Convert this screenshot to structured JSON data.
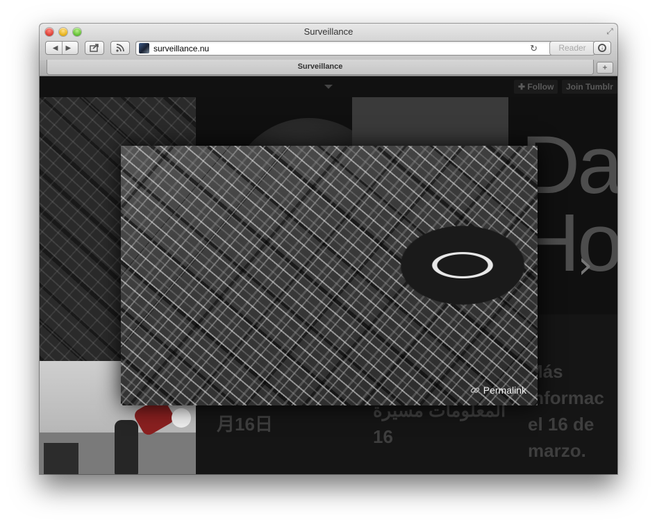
{
  "window": {
    "title": "Surveillance"
  },
  "toolbar": {
    "url": "surveillance.nu",
    "reader_label": "Reader",
    "reload_glyph": "↻",
    "back_glyph": "◀",
    "forward_glyph": "▶"
  },
  "tabs": [
    {
      "label": "Surveillance"
    }
  ],
  "tumblr_bar": {
    "follow_label": "Follow",
    "join_label": "Join Tumblr",
    "follow_glyph": "✚"
  },
  "tiles": {
    "big_text": "Da\nHo",
    "japanese_date": "月16日",
    "arabic_text": "المعلومات مسيرة\n16",
    "spanish_text": "Más\ninformac\nel 16 de\nmarzo."
  },
  "lightbox": {
    "permalink_label": "Permalink"
  },
  "icons": [
    "share-icon",
    "rss-icon",
    "download-icon",
    "link-icon",
    "chevron-right-icon",
    "fullscreen-icon"
  ]
}
